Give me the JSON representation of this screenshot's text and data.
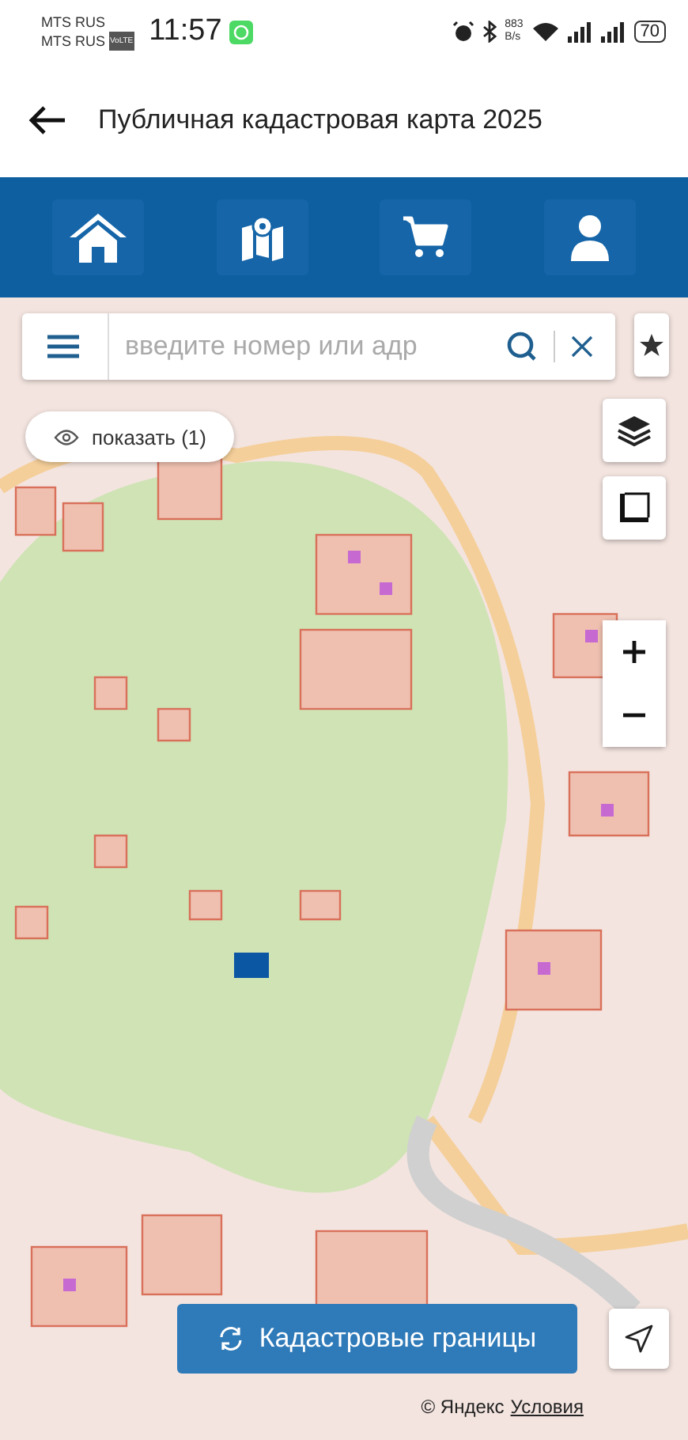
{
  "status_bar": {
    "carriers": [
      "MTS RUS",
      "MTS RUS"
    ],
    "volte": "VoLTE",
    "time": "11:57",
    "speed": [
      "883",
      "B/s"
    ],
    "battery": "70"
  },
  "header": {
    "title": "Публичная кадастровая карта 2025"
  },
  "search": {
    "placeholder": "введите номер или адр"
  },
  "show_chip": {
    "label": "показать (1)"
  },
  "layers_button": {
    "label": "Кадастровые границы"
  },
  "attribution": {
    "copyright": "© Яндекс",
    "link": "Условия"
  }
}
